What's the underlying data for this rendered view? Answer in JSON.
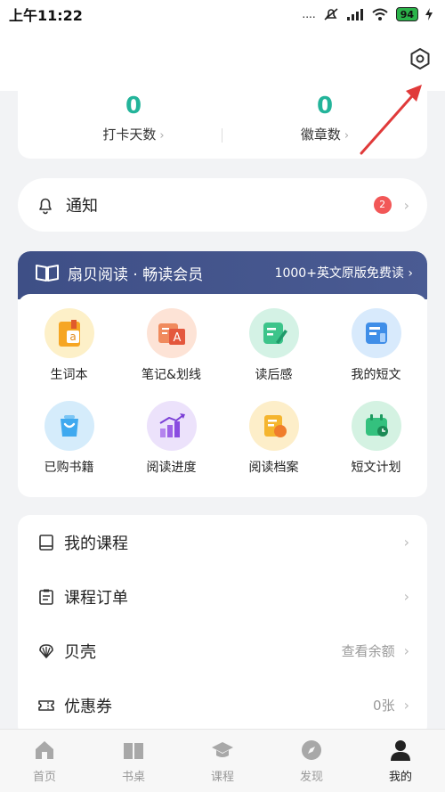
{
  "status": {
    "time": "上午11:22",
    "signal": "....",
    "battery": "94"
  },
  "stats": [
    {
      "value": "0",
      "label": "打卡天数"
    },
    {
      "value": "0",
      "label": "徽章数"
    }
  ],
  "notice": {
    "title": "通知",
    "badge": "2"
  },
  "vip": {
    "name": "扇贝阅读 · 畅读会员",
    "promo": "1000+英文原版免费读 ›",
    "items": [
      {
        "label": "生词本",
        "icon": "vocabulary-book-icon"
      },
      {
        "label": "笔记&划线",
        "icon": "notes-icon"
      },
      {
        "label": "读后感",
        "icon": "review-icon"
      },
      {
        "label": "我的短文",
        "icon": "my-articles-icon"
      },
      {
        "label": "已购书籍",
        "icon": "purchased-books-icon"
      },
      {
        "label": "阅读进度",
        "icon": "reading-progress-icon"
      },
      {
        "label": "阅读档案",
        "icon": "reading-archive-icon"
      },
      {
        "label": "短文计划",
        "icon": "article-plan-icon"
      }
    ]
  },
  "menu": [
    {
      "label": "我的课程",
      "value": ""
    },
    {
      "label": "课程订单",
      "value": ""
    },
    {
      "label": "贝壳",
      "value": "查看余额"
    },
    {
      "label": "优惠券",
      "value": "0张"
    }
  ],
  "tabs": [
    {
      "label": "首页",
      "icon": "home-icon"
    },
    {
      "label": "书桌",
      "icon": "book-icon"
    },
    {
      "label": "课程",
      "icon": "graduation-cap-icon"
    },
    {
      "label": "发现",
      "icon": "compass-icon"
    },
    {
      "label": "我的",
      "icon": "profile-icon"
    }
  ],
  "colors": {
    "accent": "#23b49a",
    "vip": "#3e4f86",
    "badge": "#f25757",
    "annotation": "#e03a3a"
  }
}
